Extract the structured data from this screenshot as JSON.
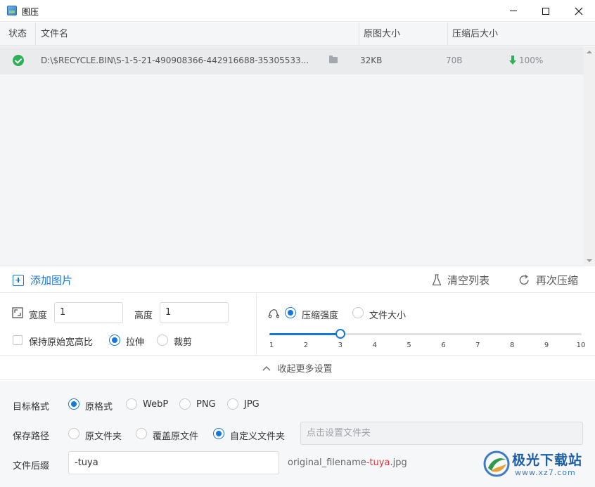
{
  "window": {
    "title": "图压"
  },
  "table": {
    "headers": {
      "status": "状态",
      "filename": "文件名",
      "original_size": "原图大小",
      "compressed_size": "压缩后大小"
    },
    "rows": [
      {
        "status": "success",
        "filename": "D:\\$RECYCLE.BIN\\S-1-5-21-490908366-442916688-35305533...",
        "original_size": "32KB",
        "compressed_size": "70B",
        "ratio": "100%"
      }
    ]
  },
  "actions": {
    "add": "添加图片",
    "clear": "清空列表",
    "recompress": "再次压缩"
  },
  "resize": {
    "width_label": "宽度",
    "width_value": "1",
    "height_label": "高度",
    "height_value": "1",
    "keep_ratio_label": "保持原始宽高比",
    "keep_ratio_checked": false,
    "stretch_label": "拉伸",
    "crop_label": "裁剪",
    "mode": "stretch"
  },
  "compress": {
    "strength_label": "压缩强度",
    "filesize_label": "文件大小",
    "mode": "strength",
    "slider": {
      "min": 1,
      "max": 10,
      "value": 3,
      "ticks": [
        "1",
        "2",
        "3",
        "4",
        "5",
        "6",
        "7",
        "8",
        "9",
        "10"
      ]
    }
  },
  "collapse_label": "收起更多设置",
  "target_format": {
    "label": "目标格式",
    "options": [
      "原格式",
      "WebP",
      "PNG",
      "JPG"
    ],
    "selected": "原格式"
  },
  "save_path": {
    "label": "保存路径",
    "options": [
      "原文件夹",
      "覆盖原文件",
      "自定义文件夹"
    ],
    "selected": "自定义文件夹",
    "placeholder": "点击设置文件夹"
  },
  "suffix": {
    "label": "文件后缀",
    "value": "-tuya",
    "preview_base": "original_filename",
    "preview_suffix": "-tuya",
    "preview_ext": ".jpg"
  },
  "watermark": {
    "name": "极光下载站",
    "url": "www.xz7.com"
  },
  "colors": {
    "accent": "#1677d8",
    "success": "#2eb058",
    "suffix_highlight": "#e0323a"
  }
}
